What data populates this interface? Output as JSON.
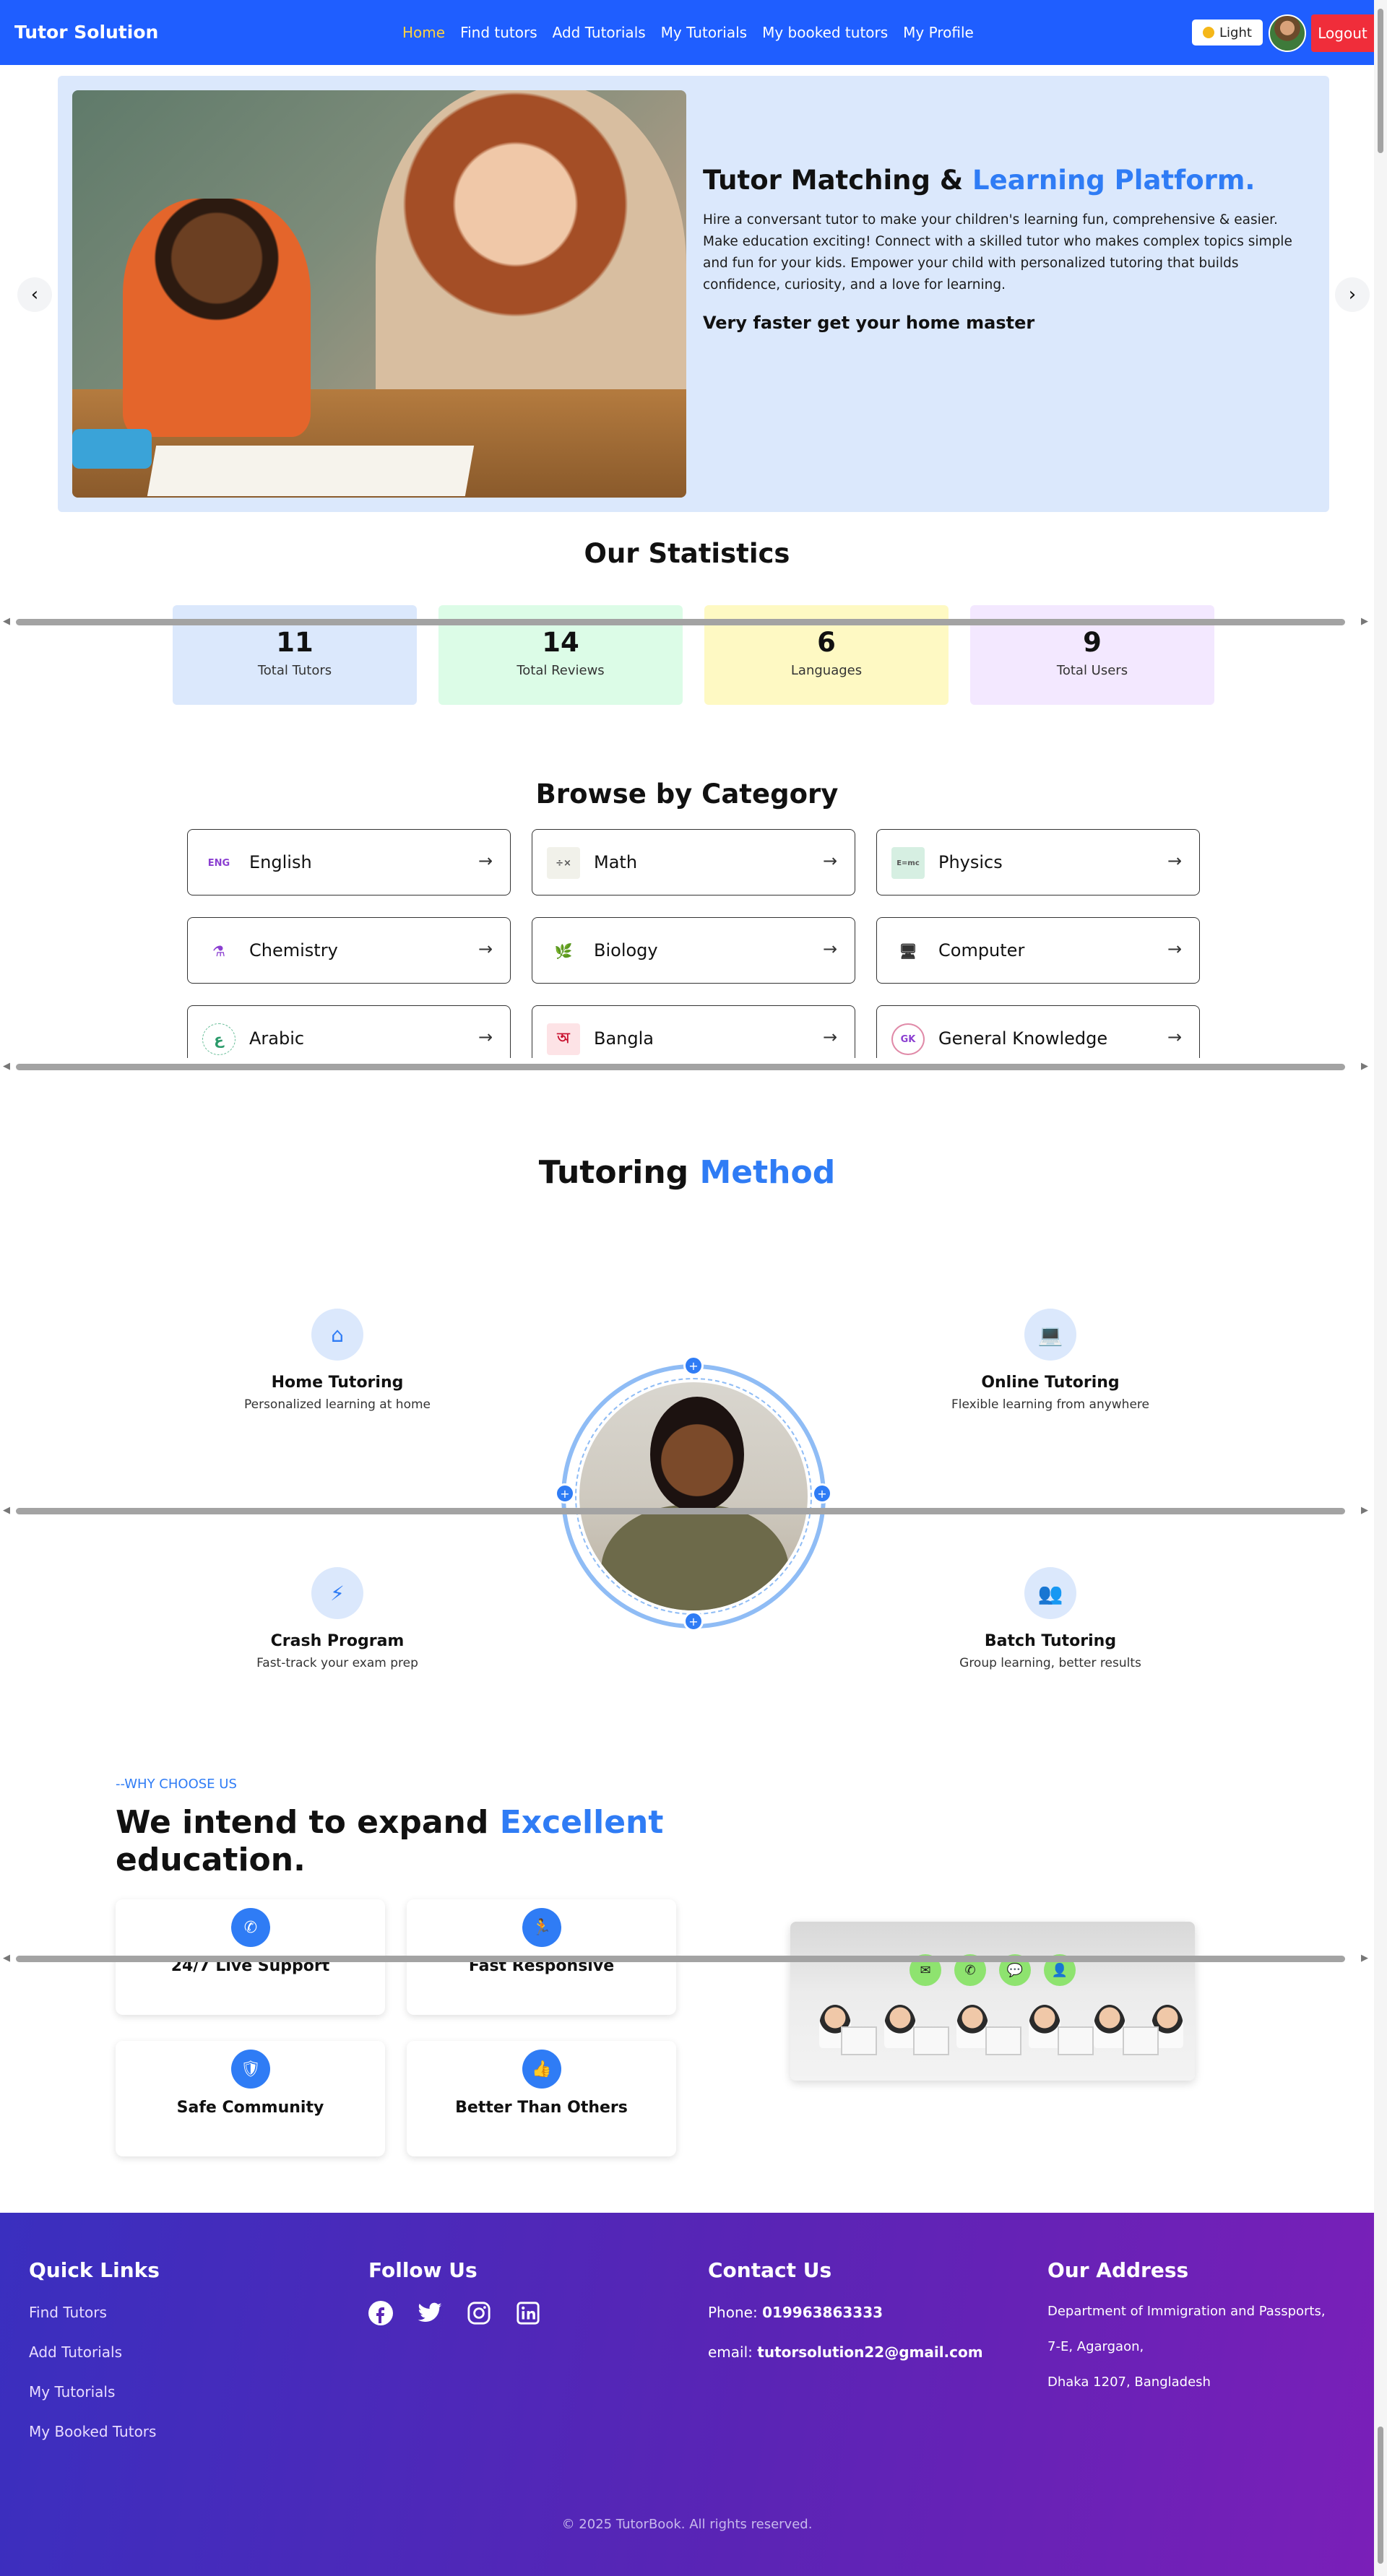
{
  "nav": {
    "brand": "Tutor Solution",
    "links": [
      "Home",
      "Find tutors",
      "Add Tutorials",
      "My Tutorials",
      "My booked tutors",
      "My Profile"
    ],
    "theme_label": "Light",
    "logout_label": "Logout"
  },
  "hero": {
    "title_main": "Tutor Matching & ",
    "title_accent": "Learning Platform.",
    "description": "Hire a conversant tutor to make your children's learning fun, comprehensive & easier. Make education exciting! Connect with a skilled tutor who makes complex topics simple and fun for your kids. Empower your child with personalized tutoring that builds confidence, curiosity, and a love for learning.",
    "subtitle": "Very faster get your home master",
    "prev_icon": "‹",
    "next_icon": "›"
  },
  "stats": {
    "title": "Our Statistics",
    "items": [
      {
        "value": "11",
        "label": "Total Tutors",
        "color": "#dbe8fc"
      },
      {
        "value": "14",
        "label": "Total Reviews",
        "color": "#dcfce7"
      },
      {
        "value": "6",
        "label": "Languages",
        "color": "#fef9c3"
      },
      {
        "value": "9",
        "label": "Total Users",
        "color": "#f3e8ff"
      }
    ]
  },
  "categories": {
    "title": "Browse by Category",
    "items": [
      {
        "label": "English",
        "icon": "ENG"
      },
      {
        "label": "Math",
        "icon": "÷×"
      },
      {
        "label": "Physics",
        "icon": "E=mc"
      },
      {
        "label": "Chemistry",
        "icon": "⚗"
      },
      {
        "label": "Biology",
        "icon": "🌿"
      },
      {
        "label": "Computer",
        "icon": "🖥"
      },
      {
        "label": "Arabic",
        "icon": "ع"
      },
      {
        "label": "Bangla",
        "icon": "অ"
      },
      {
        "label": "General Knowledge",
        "icon": "GK"
      }
    ]
  },
  "method": {
    "title_main": "Tutoring ",
    "title_accent": "Method",
    "items": [
      {
        "title": "Home Tutoring",
        "desc": "Personalized learning at home",
        "icon": "⌂"
      },
      {
        "title": "Online Tutoring",
        "desc": "Flexible learning from anywhere",
        "icon": "💻"
      },
      {
        "title": "Crash Program",
        "desc": "Fast-track your exam prep",
        "icon": "⚡"
      },
      {
        "title": "Batch Tutoring",
        "desc": "Group learning, better results",
        "icon": "👥"
      }
    ],
    "dot_icon": "+"
  },
  "why": {
    "tag": "--WHY CHOOSE US",
    "title_main": "We intend to expand ",
    "title_accent": "Excellent",
    "title_end": "education.",
    "features": [
      {
        "label": "24/7 Live Support",
        "icon": "✆"
      },
      {
        "label": "Fast Responsive",
        "icon": "🏃"
      },
      {
        "label": "Safe Community",
        "icon": "🛡"
      },
      {
        "label": "Better Than Others",
        "icon": "👍"
      }
    ]
  },
  "footer": {
    "quick_links_title": "Quick Links",
    "quick_links": [
      "Find Tutors",
      "Add Tutorials",
      "My Tutorials",
      "My Booked Tutors"
    ],
    "follow_title": "Follow Us",
    "contact_title": "Contact Us",
    "phone_label": "Phone: ",
    "phone": "019963863333",
    "email_label": "email: ",
    "email": "tutorsolution22@gmail.com",
    "address_title": "Our Address",
    "address_lines": [
      "Department of Immigration and Passports,",
      "7-E, Agargaon,",
      "Dhaka 1207, Bangladesh"
    ],
    "copyright": "© 2025 TutorBook. All rights reserved."
  }
}
